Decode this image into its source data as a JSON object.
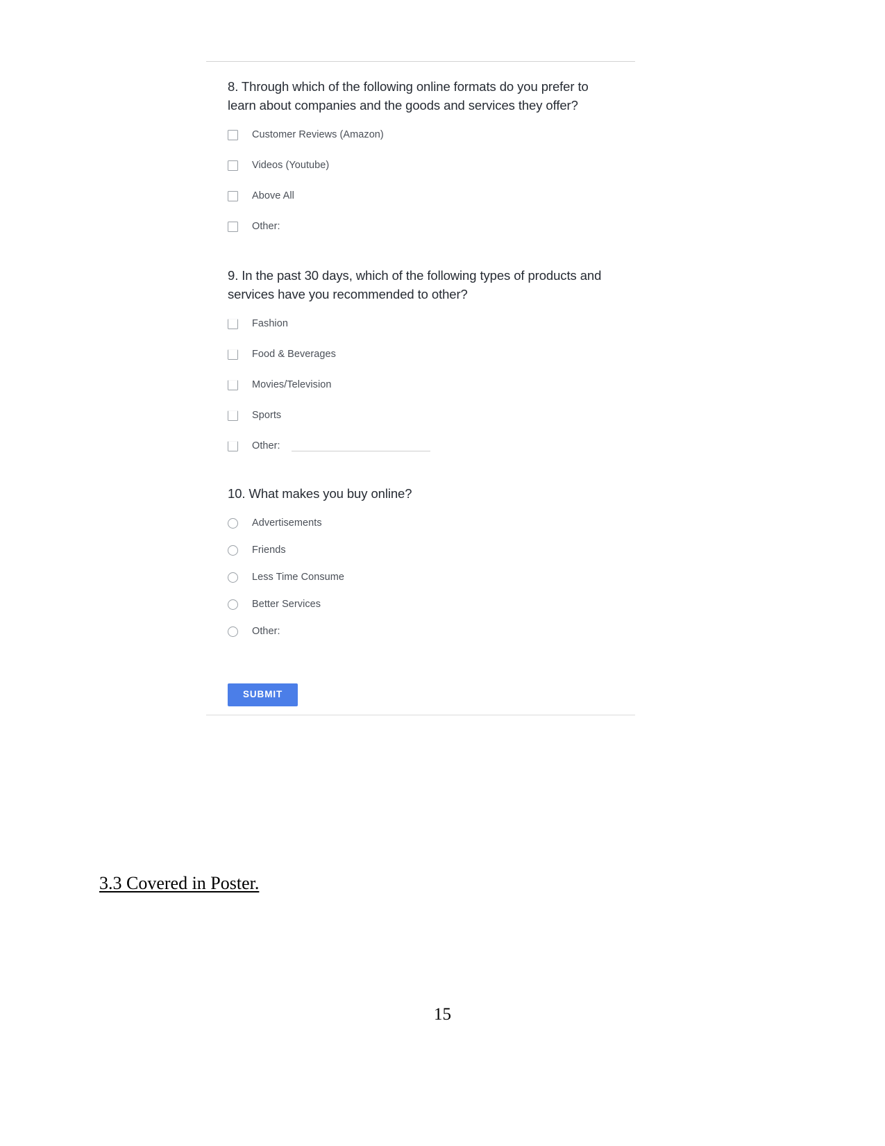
{
  "document": {
    "heading": "3.3 Covered in Poster.",
    "page_number": "15"
  },
  "form": {
    "submit_label": "SUBMIT",
    "accent_color": "#4b7ee8",
    "questions": [
      {
        "number": "8",
        "title": "8. Through which of the following online formats do you prefer to learn about companies and the goods and services they offer?",
        "input_type": "checkbox",
        "options": [
          {
            "label": "Customer Reviews (Amazon)",
            "has_other_line": false
          },
          {
            "label": "Videos (Youtube)",
            "has_other_line": false
          },
          {
            "label": "Above All",
            "has_other_line": false
          },
          {
            "label": "Other:",
            "has_other_line": false
          }
        ]
      },
      {
        "number": "9",
        "title": "9. In the past 30 days, which of the following types of products and services have you recommended to other?",
        "input_type": "checkbox",
        "options": [
          {
            "label": "Fashion",
            "has_other_line": false
          },
          {
            "label": "Food & Beverages",
            "has_other_line": false
          },
          {
            "label": "Movies/Television",
            "has_other_line": false
          },
          {
            "label": "Sports",
            "has_other_line": false
          },
          {
            "label": "Other:",
            "has_other_line": true
          }
        ]
      },
      {
        "number": "10",
        "title": "10. What makes you buy online?",
        "input_type": "radio",
        "options": [
          {
            "label": "Advertisements",
            "has_other_line": false
          },
          {
            "label": "Friends",
            "has_other_line": false
          },
          {
            "label": "Less Time Consume",
            "has_other_line": false
          },
          {
            "label": "Better Services",
            "has_other_line": false
          },
          {
            "label": "Other:",
            "has_other_line": false
          }
        ]
      }
    ]
  }
}
